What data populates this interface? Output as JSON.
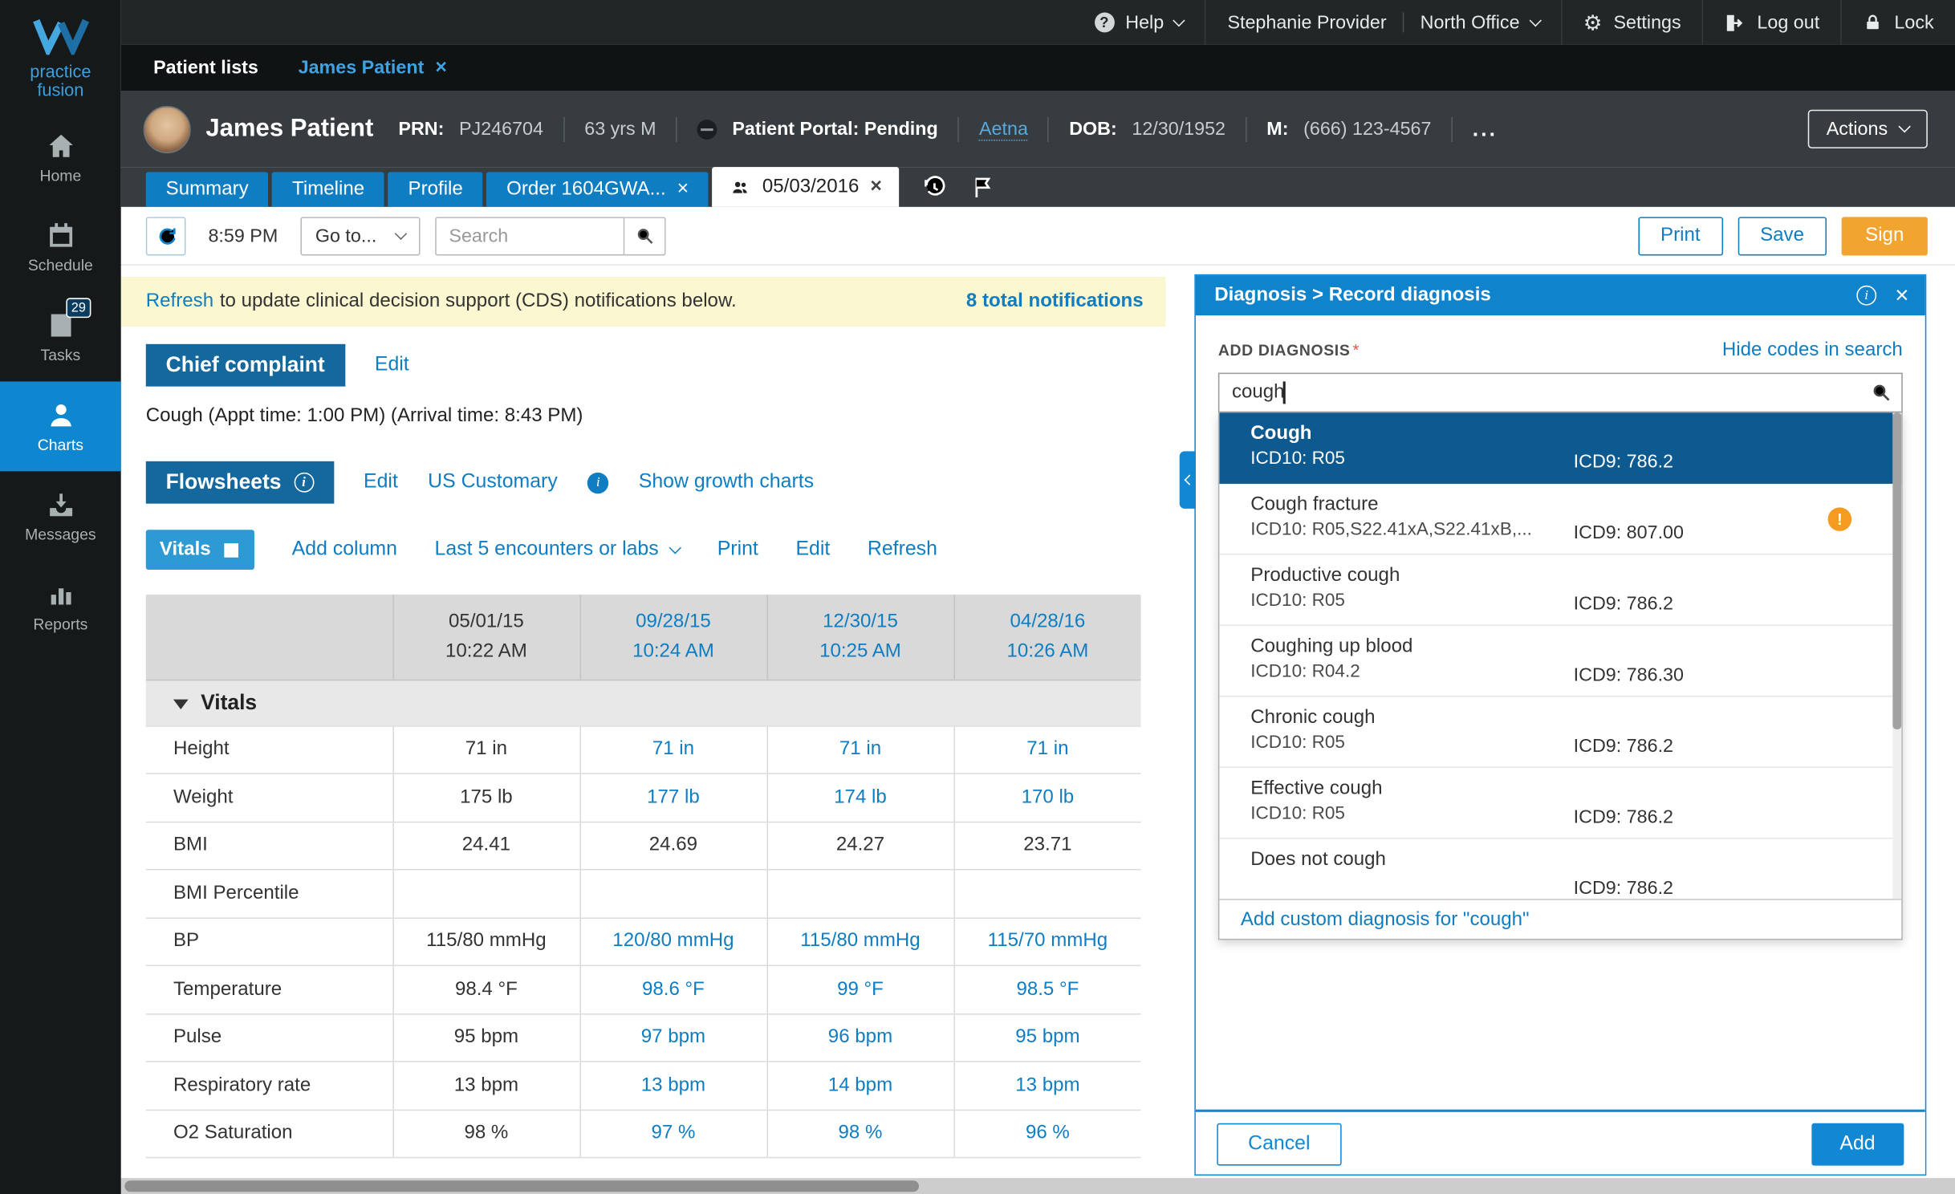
{
  "colors": {
    "accent_blue": "#0f7dc2",
    "panel_blue": "#1287d3",
    "section_blue": "#14689e",
    "selected_blue": "#0d5a90",
    "sign_orange": "#f2a431",
    "warning_orange": "#f49b20",
    "cds_yellow": "#fbf7d0"
  },
  "icons": {
    "close": "×",
    "help_glyph": "?",
    "gear": "⚙",
    "info_glyph": "i"
  },
  "topbar": {
    "help": "Help",
    "user": "Stephanie Provider",
    "office": "North Office",
    "settings": "Settings",
    "logout": "Log out",
    "lock": "Lock"
  },
  "sidebar": {
    "logo_line1": "practice",
    "logo_line2": "fusion",
    "items": [
      {
        "label": "Home",
        "icon": "home"
      },
      {
        "label": "Schedule",
        "icon": "calendar"
      },
      {
        "label": "Tasks",
        "icon": "tasks",
        "badge": "29"
      },
      {
        "label": "Charts",
        "icon": "charts",
        "active": true
      },
      {
        "label": "Messages",
        "icon": "messages"
      },
      {
        "label": "Reports",
        "icon": "reports"
      }
    ]
  },
  "tabstrip": {
    "patient_lists": "Patient lists",
    "patient_tab": "James Patient"
  },
  "patient": {
    "name": "James Patient",
    "prn_label": "PRN:",
    "prn": "PJ246704",
    "age_sex": "63 yrs M",
    "portal": "Patient Portal: Pending",
    "insurance": "Aetna",
    "dob_label": "DOB:",
    "dob": "12/30/1952",
    "phone_label": "M:",
    "phone": "(666) 123-4567",
    "more": "...",
    "actions": "Actions"
  },
  "chart_tabs": {
    "tabs": [
      {
        "label": "Summary"
      },
      {
        "label": "Timeline"
      },
      {
        "label": "Profile"
      },
      {
        "label": "Order 1604GWA...",
        "closable": true
      },
      {
        "label": "05/03/2016",
        "closable": true,
        "active": true,
        "icon": "patients"
      }
    ]
  },
  "toolbar": {
    "time": "8:59 PM",
    "goto": "Go to...",
    "search_placeholder": "Search",
    "print": "Print",
    "save": "Save",
    "sign": "Sign"
  },
  "cds": {
    "refresh_link": "Refresh",
    "message": "to update clinical decision support (CDS) notifications below.",
    "total": "8 total notifications"
  },
  "chief_complaint": {
    "title": "Chief complaint",
    "edit": "Edit",
    "text": "Cough  (Appt time: 1:00 PM) (Arrival time: 8:43 PM)"
  },
  "flowsheets": {
    "title": "Flowsheets",
    "edit": "Edit",
    "units": "US Customary",
    "growth": "Show growth charts",
    "vitals_button": "Vitals",
    "add_column": "Add column",
    "range": "Last 5 encounters or labs",
    "print": "Print",
    "edit_table": "Edit",
    "refresh": "Refresh"
  },
  "flowsheet_table": {
    "type": "table",
    "group": "Vitals",
    "columns": [
      {
        "date": "05/01/15",
        "time": "10:22 AM",
        "link": false
      },
      {
        "date": "09/28/15",
        "time": "10:24 AM",
        "link": true
      },
      {
        "date": "12/30/15",
        "time": "10:25 AM",
        "link": true
      },
      {
        "date": "04/28/16",
        "time": "10:26 AM",
        "link": true
      }
    ],
    "rows": [
      {
        "label": "Height",
        "values": [
          "71 in",
          "71 in",
          "71 in",
          "71 in"
        ],
        "links": [
          false,
          true,
          true,
          true
        ]
      },
      {
        "label": "Weight",
        "values": [
          "175 lb",
          "177 lb",
          "174 lb",
          "170 lb"
        ],
        "links": [
          false,
          true,
          true,
          true
        ]
      },
      {
        "label": "BMI",
        "values": [
          "24.41",
          "24.69",
          "24.27",
          "23.71"
        ],
        "links": [
          false,
          false,
          false,
          false
        ]
      },
      {
        "label": "BMI Percentile",
        "values": [
          "",
          "",
          "",
          ""
        ],
        "links": [
          false,
          false,
          false,
          false
        ]
      },
      {
        "label": "BP",
        "values": [
          "115/80 mmHg",
          "120/80 mmHg",
          "115/80 mmHg",
          "115/70 mmHg"
        ],
        "links": [
          false,
          true,
          true,
          true
        ]
      },
      {
        "label": "Temperature",
        "values": [
          "98.4 °F",
          "98.6 °F",
          "99 °F",
          "98.5 °F"
        ],
        "links": [
          false,
          true,
          true,
          true
        ]
      },
      {
        "label": "Pulse",
        "values": [
          "95 bpm",
          "97 bpm",
          "96 bpm",
          "95 bpm"
        ],
        "links": [
          false,
          true,
          true,
          true
        ]
      },
      {
        "label": "Respiratory rate",
        "values": [
          "13 bpm",
          "13 bpm",
          "14 bpm",
          "13 bpm"
        ],
        "links": [
          false,
          true,
          true,
          true
        ]
      },
      {
        "label": "O2 Saturation",
        "values": [
          "98 %",
          "97 %",
          "98 %",
          "96 %"
        ],
        "links": [
          false,
          true,
          true,
          true
        ]
      }
    ]
  },
  "diagnosis_panel": {
    "breadcrumb": "Diagnosis > Record diagnosis",
    "add_label": "ADD DIAGNOSIS",
    "required": "*",
    "hide_codes": "Hide codes in search",
    "search_value": "cough",
    "results": [
      {
        "name": "Cough",
        "icd10": "ICD10: R05",
        "icd9": "ICD9: 786.2",
        "selected": true
      },
      {
        "name": "Cough fracture",
        "icd10": "ICD10: R05,S22.41xA,S22.41xB,...",
        "icd9": "ICD9: 807.00",
        "warning": true
      },
      {
        "name": "Productive cough",
        "icd10": "ICD10: R05",
        "icd9": "ICD9: 786.2"
      },
      {
        "name": "Coughing up blood",
        "icd10": "ICD10: R04.2",
        "icd9": "ICD9: 786.30"
      },
      {
        "name": "Chronic cough",
        "icd10": "ICD10: R05",
        "icd9": "ICD9: 786.2"
      },
      {
        "name": "Effective cough",
        "icd10": "ICD10: R05",
        "icd9": "ICD9: 786.2"
      },
      {
        "name": "Does not cough",
        "icd10": "",
        "icd9": "ICD9: 786.2"
      }
    ],
    "add_custom": "Add custom diagnosis for \"cough\"",
    "cancel": "Cancel",
    "add": "Add",
    "warning_glyph": "!"
  }
}
